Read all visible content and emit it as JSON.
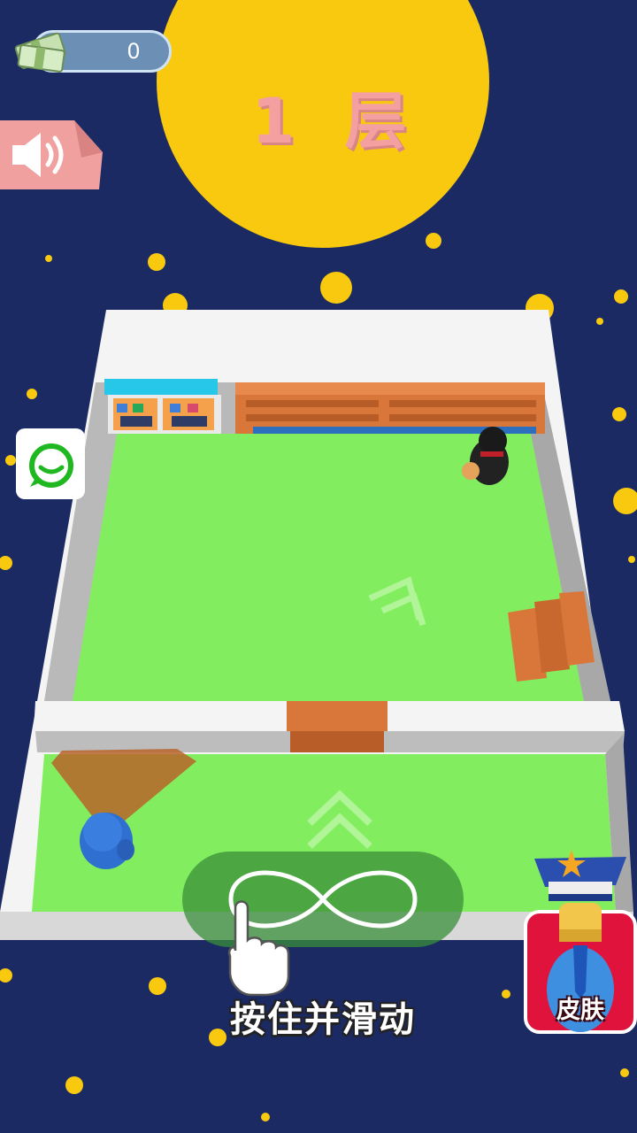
{
  "hud": {
    "money_value": "0",
    "level_label": "1 层",
    "sound_icon": "speaker-icon",
    "chat_icon": "chat-bubble-icon"
  },
  "controls": {
    "hint_text": "按住并滑动",
    "gesture_icon": "infinity-swipe-icon",
    "pointer_icon": "hand-pointer-icon"
  },
  "skin_button": {
    "label": "皮肤",
    "icon": "police-officer-icon"
  },
  "colors": {
    "background": "#1b2a63",
    "moon": "#f8c90f",
    "floor": "#82ee5f",
    "wall": "#f4f4f4",
    "furniture": "#d9773b",
    "level_text": "#f4a0a0",
    "skin_button_bg": "#e0133c"
  }
}
